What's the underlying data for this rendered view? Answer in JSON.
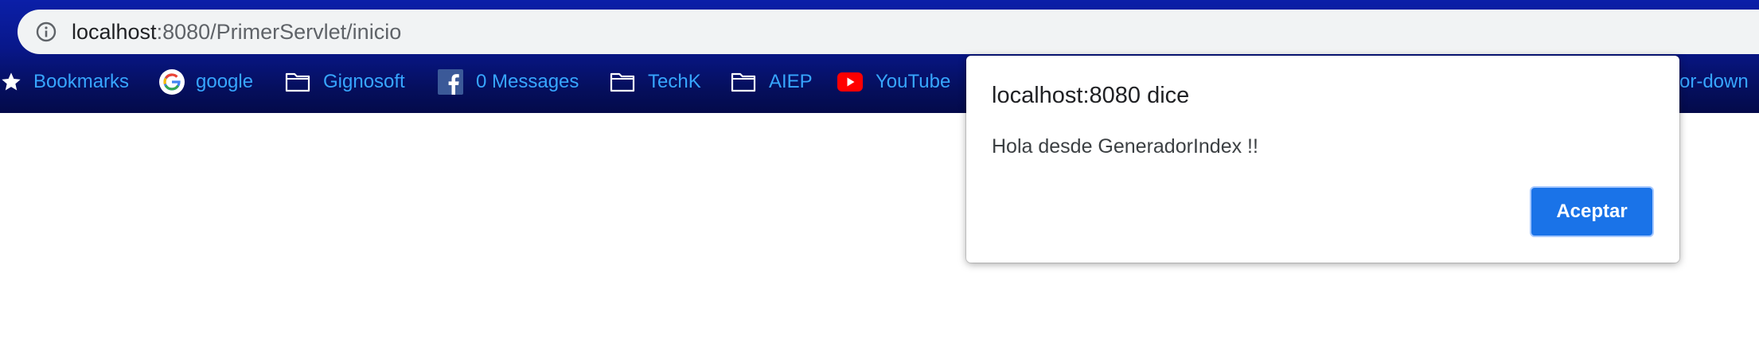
{
  "address_bar": {
    "url_host": "localhost",
    "url_rest": ":8080/PrimerServlet/inicio"
  },
  "bookmarks": [
    {
      "icon": "star-icon",
      "label": "Bookmarks"
    },
    {
      "icon": "google-icon",
      "label": "google"
    },
    {
      "icon": "folder-icon",
      "label": "Gignosoft"
    },
    {
      "icon": "facebook-icon",
      "label": "0 Messages"
    },
    {
      "icon": "folder-icon",
      "label": "TechK"
    },
    {
      "icon": "folder-icon",
      "label": "AIEP"
    },
    {
      "icon": "youtube-icon",
      "label": "YouTube"
    },
    {
      "icon": "",
      "label": "rror-down"
    }
  ],
  "dialog": {
    "title": "localhost:8080 dice",
    "message": "Hola desde GeneradorIndex !!",
    "ok_label": "Aceptar"
  },
  "colors": {
    "toolbar_gradient_top": "#0b1fa8",
    "toolbar_gradient_bottom": "#040a4a",
    "bookmark_text": "#37a6ff",
    "button_primary": "#1a73e8"
  }
}
